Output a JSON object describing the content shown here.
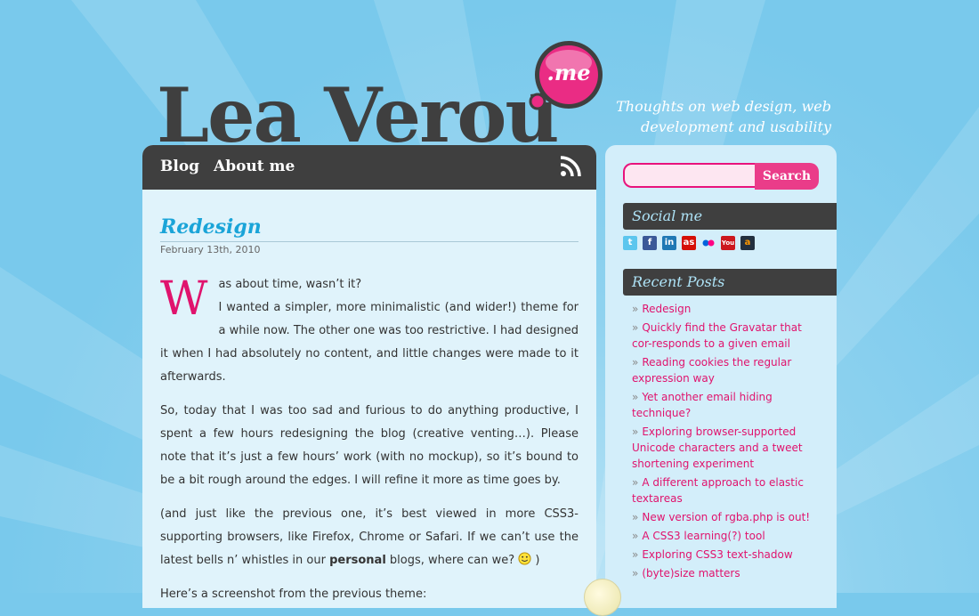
{
  "header": {
    "title": "Lea Verou",
    "badge": ".me",
    "tagline": "Thoughts on web design, web development and usability"
  },
  "nav": {
    "items": [
      "Blog",
      "About me"
    ],
    "rss_icon": "rss-icon"
  },
  "post": {
    "title": "Redesign",
    "date": "February 13th, 2010",
    "dropcap": "W",
    "p1_rest": "as about time, wasn’t it?",
    "p2": "I wanted a simpler, more minimalistic (and wider!) theme for a while now. The other one was too restrictive. I had designed it when I had absolutely no content, and little changes were made to it afterwards.",
    "p3": "So, today that I was too sad and furious to do anything productive, I spent a few hours redesigning the blog (creative venting…). Please note that it’s just a few hours’ work (with no mockup), so it’s bound to be a bit rough around the edges. I will refine it more as time goes by.",
    "p4_start": "(and just like the previous one, it’s best viewed in more CSS3-supporting browsers, like Firefox, Chrome or Safari. If we can’t use the latest bells n’ whistles in our ",
    "p4_bold": "personal",
    "p4_end": " blogs, where can we? ",
    "p4_close": ")",
    "p5": "Here’s a screenshot from the previous theme:"
  },
  "sidebar": {
    "search_button": "Search",
    "social_heading": "Social me",
    "social_icons": [
      "twitter-icon",
      "facebook-icon",
      "linkedin-icon",
      "lastfm-icon",
      "flickr-icon",
      "youtube-icon",
      "amazon-icon"
    ],
    "recent_heading": "Recent Posts",
    "recent_posts": [
      "Redesign",
      "Quickly find the Gravatar that cor-responds to a given email",
      "Reading cookies the regular expression way",
      "Yet another email hiding technique?",
      "Exploring browser-supported Unicode characters and a tweet shortening experiment",
      "A different approach to elastic textareas",
      "New version of rgba.php is out!",
      "A CSS3 learning(?) tool",
      "Exploring CSS3 text-shadow",
      "(byte)size matters"
    ]
  },
  "colors": {
    "accent": "#e0136d",
    "link_blue": "#1aa4d8",
    "dark": "#3f3f3f"
  }
}
